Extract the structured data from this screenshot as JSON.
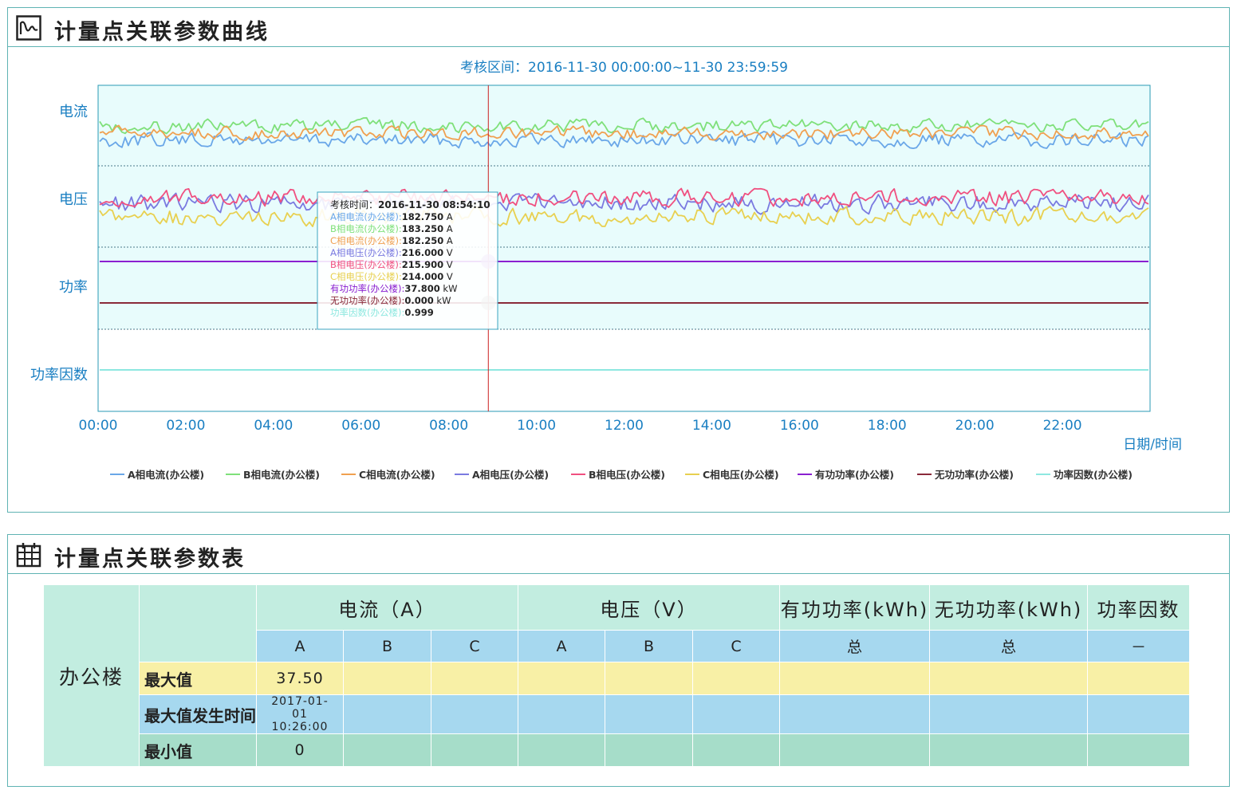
{
  "chart_panel": {
    "title": "计量点关联参数曲线"
  },
  "table_panel": {
    "title": "计量点关联参数表"
  },
  "chart_data": {
    "type": "line",
    "title": "考核区间：2016-11-30    00:00:00~11-30    23:59:59",
    "xlabel": "日期/时间",
    "x_ticks": [
      "00:00",
      "02:00",
      "04:00",
      "06:00",
      "08:00",
      "10:00",
      "12:00",
      "14:00",
      "16:00",
      "18:00",
      "20:00",
      "22:00"
    ],
    "x_range": [
      "00:00",
      "23:59:59"
    ],
    "grid": "dotted horizontal panel separators",
    "legend_position": "bottom",
    "panels": [
      {
        "label": "电流",
        "series": [
          "A相电流(办公楼)",
          "B相电流(办公楼)",
          "C相电流(办公楼)"
        ]
      },
      {
        "label": "电压",
        "series": [
          "A相电压(办公楼)",
          "B相电压(办公楼)",
          "C相电压(办公楼)"
        ]
      },
      {
        "label": "功率",
        "series": [
          "有功功率(办公楼)",
          "无功功率(办公楼)"
        ]
      },
      {
        "label": "功率因数",
        "series": [
          "功率因数(办公楼)"
        ]
      }
    ],
    "series": [
      {
        "name": "A相电流(办公楼)",
        "color": "#6aa7e8",
        "unit": "A",
        "typical": 182.75,
        "fluctuation": "high"
      },
      {
        "name": "B相电流(办公楼)",
        "color": "#7fe07a",
        "unit": "A",
        "typical": 183.25,
        "fluctuation": "high"
      },
      {
        "name": "C相电流(办公楼)",
        "color": "#f0a050",
        "unit": "A",
        "typical": 182.25,
        "fluctuation": "high"
      },
      {
        "name": "A相电压(办公楼)",
        "color": "#7a7ae0",
        "unit": "V",
        "typical": 216.0,
        "fluctuation": "high"
      },
      {
        "name": "B相电压(办公楼)",
        "color": "#f05080",
        "unit": "V",
        "typical": 215.9,
        "fluctuation": "high"
      },
      {
        "name": "C相电压(办公楼)",
        "color": "#e8d050",
        "unit": "V",
        "typical": 214.0,
        "fluctuation": "high"
      },
      {
        "name": "有功功率(办公楼)",
        "color": "#8a1fd0",
        "unit": "kW",
        "typical": 37.8,
        "fluctuation": "flat"
      },
      {
        "name": "无功功率(办公楼)",
        "color": "#8a2a3a",
        "unit": "kW",
        "typical": 0.0,
        "fluctuation": "flat"
      },
      {
        "name": "功率因数(办公楼)",
        "color": "#8ee8e0",
        "unit": "",
        "typical": 0.999,
        "fluctuation": "flat"
      }
    ],
    "cursor_time": "2016-11-30 08:54:10",
    "tooltip": {
      "time_label": "考核时间：",
      "time_value": "2016-11-30 08:54:10",
      "rows": [
        {
          "name": "A相电流(办公楼)",
          "value": "182.750",
          "unit": "A"
        },
        {
          "name": "B相电流(办公楼)",
          "value": "183.250",
          "unit": "A"
        },
        {
          "name": "C相电流(办公楼)",
          "value": "182.250",
          "unit": "A"
        },
        {
          "name": "A相电压(办公楼)",
          "value": "216.000",
          "unit": "V"
        },
        {
          "name": "B相电压(办公楼)",
          "value": "215.900",
          "unit": "V"
        },
        {
          "name": "C相电压(办公楼)",
          "value": "214.000",
          "unit": "V"
        },
        {
          "name": "有功功率(办公楼)",
          "value": "37.800",
          "unit": "kW"
        },
        {
          "name": "无功功率(办公楼)",
          "value": "0.000",
          "unit": "kW"
        },
        {
          "name": "功率因数(办公楼)",
          "value": "0.999",
          "unit": ""
        }
      ]
    }
  },
  "table": {
    "entity": "办公楼",
    "groups": [
      "电流（A）",
      "电压（V）",
      "有功功率(kWh)",
      "无功功率(kWh)",
      "功率因数"
    ],
    "subheaders": [
      "A",
      "B",
      "C",
      "A",
      "B",
      "C",
      "总",
      "总",
      "－"
    ],
    "rows": [
      {
        "label": "最大值",
        "values": [
          "37.50",
          "",
          "",
          "",
          "",
          "",
          "",
          "",
          ""
        ]
      },
      {
        "label": "最大值发生时间",
        "values": [
          "2017-01-01 10:26:00",
          "",
          "",
          "",
          "",
          "",
          "",
          "",
          ""
        ]
      },
      {
        "label": "最小值",
        "values": [
          "0",
          "",
          "",
          "",
          "",
          "",
          "",
          "",
          ""
        ]
      }
    ]
  },
  "colors": {
    "accent": "#1a7fc2",
    "border": "#5fb3b3",
    "chart_bg": "#e8fcfc",
    "cursor": "#cc2020"
  }
}
